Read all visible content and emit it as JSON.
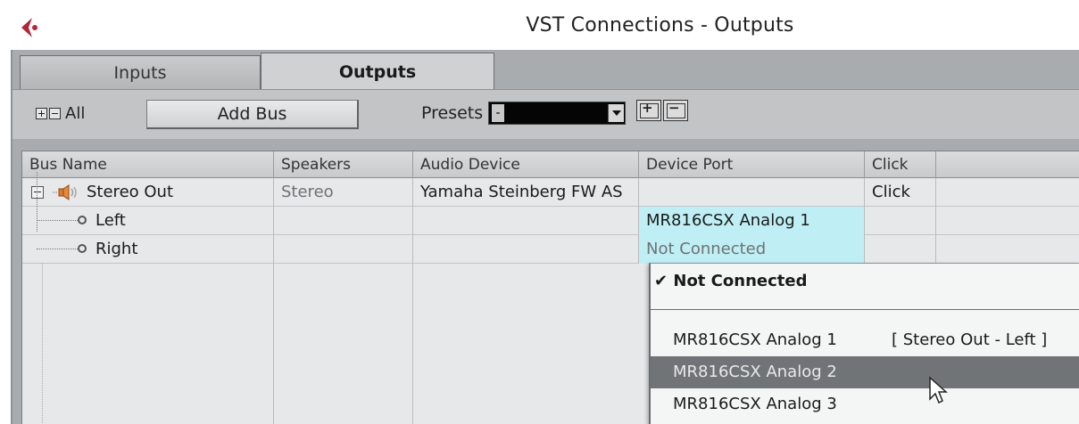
{
  "window": {
    "title": "VST Connections - Outputs"
  },
  "tabs": [
    {
      "label": "Inputs",
      "active": false
    },
    {
      "label": "Outputs",
      "active": true
    }
  ],
  "toolbar": {
    "all_label": "All",
    "add_bus_label": "Add Bus",
    "presets_label": "Presets",
    "presets_value": "-"
  },
  "table": {
    "columns": [
      "Bus Name",
      "Speakers",
      "Audio Device",
      "Device Port",
      "Click"
    ],
    "bus": {
      "name": "Stereo Out",
      "speakers": "Stereo",
      "audio_device": "Yamaha Steinberg FW AS",
      "click": "Click"
    },
    "channels": [
      {
        "name": "Left",
        "device_port": "MR816CSX Analog 1"
      },
      {
        "name": "Right",
        "device_port": "Not Connected"
      }
    ]
  },
  "port_menu": {
    "items": [
      {
        "label": "Not Connected",
        "checked": true,
        "assignment": ""
      },
      {
        "label": "MR816CSX Analog 1",
        "checked": false,
        "assignment": "[ Stereo Out - Left ]"
      },
      {
        "label": "MR816CSX Analog 2",
        "checked": false,
        "assignment": "",
        "highlighted": true
      },
      {
        "label": "MR816CSX Analog 3",
        "checked": false,
        "assignment": ""
      }
    ],
    "highlight_color": "#707476",
    "port_cell_color": "#bfeff4"
  },
  "colors": {
    "logo": "#b3263a",
    "frame": "#a9acae"
  }
}
